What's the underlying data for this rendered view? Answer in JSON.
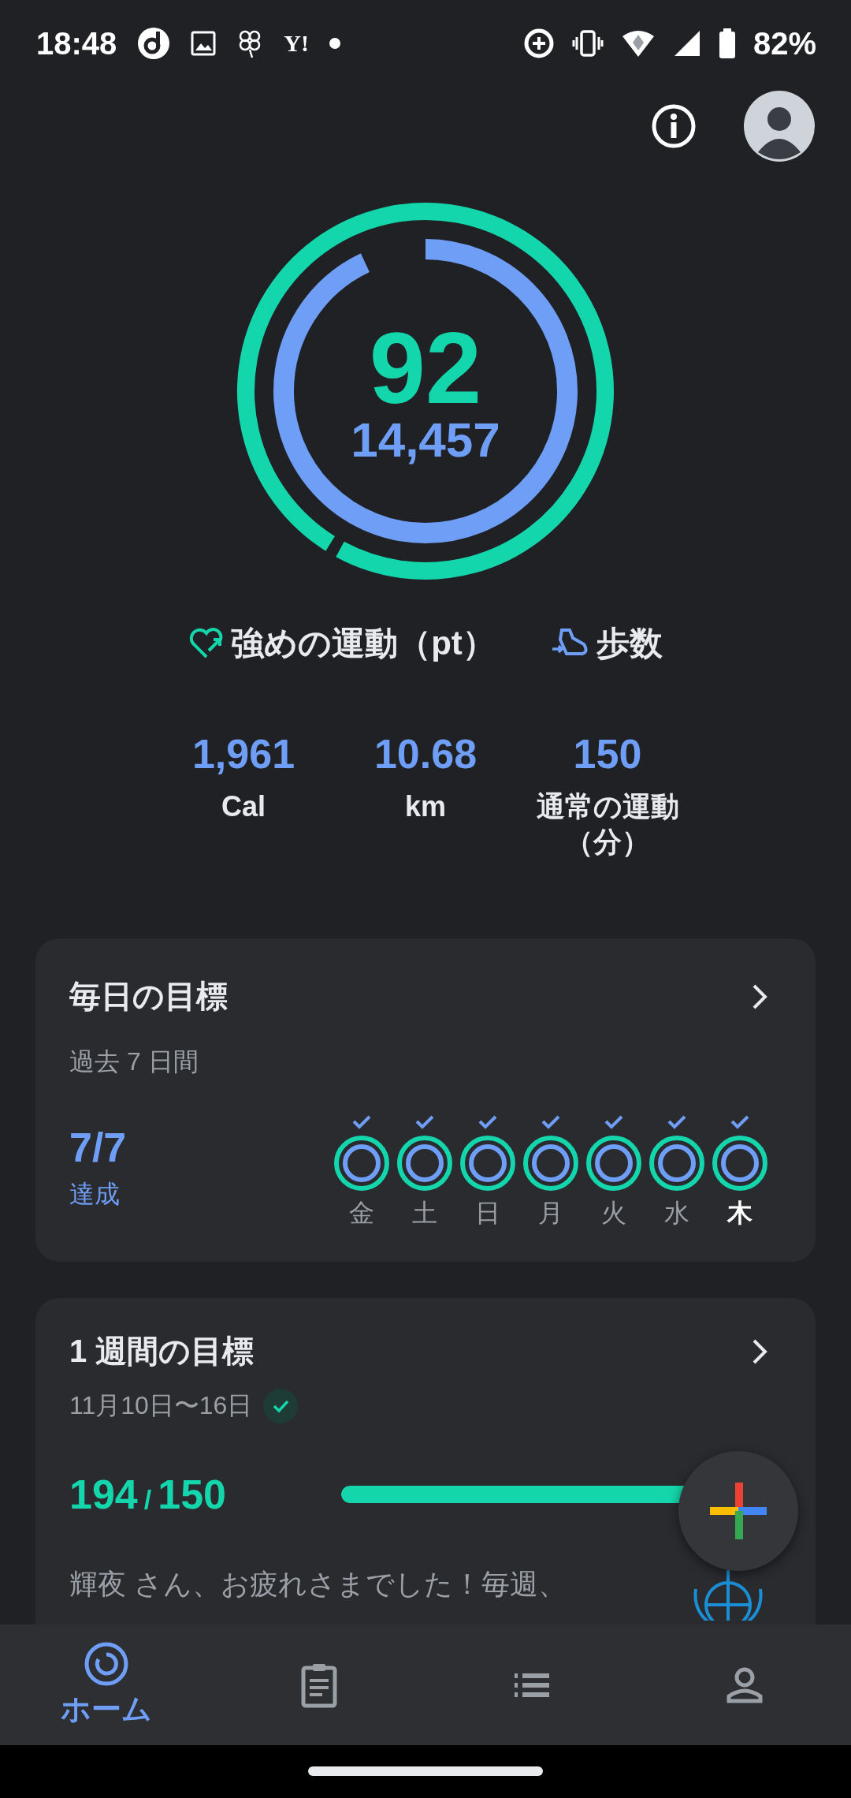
{
  "status_bar": {
    "time": "18:48",
    "notification_text": "Y!",
    "battery": "82%"
  },
  "rings": {
    "heart_points": {
      "value": "92",
      "level": 0.99
    },
    "steps": {
      "value": "14,457",
      "level": 0.93
    }
  },
  "legend": [
    {
      "kind": "heart",
      "label": "強めの運動（pt）"
    },
    {
      "kind": "steps",
      "label": "歩数"
    }
  ],
  "stats": [
    {
      "value": "1,961",
      "label": "Cal"
    },
    {
      "value": "10.68",
      "label": "km"
    },
    {
      "value": "150",
      "label": "通常の運動（分）"
    }
  ],
  "daily_goal": {
    "title": "毎日の目標",
    "subtitle": "過去 7 日間",
    "count": "7/7",
    "status": "達成",
    "days": [
      {
        "label": "金",
        "checked": true,
        "selected": false
      },
      {
        "label": "土",
        "checked": true,
        "selected": false
      },
      {
        "label": "日",
        "checked": true,
        "selected": false
      },
      {
        "label": "月",
        "checked": true,
        "selected": false
      },
      {
        "label": "火",
        "checked": true,
        "selected": false
      },
      {
        "label": "水",
        "checked": true,
        "selected": false
      },
      {
        "label": "木",
        "checked": true,
        "selected": true
      }
    ]
  },
  "weekly_goal": {
    "title": "1 週間の目標",
    "date_range": "11月10日〜16日",
    "achieved": true,
    "progress": "194",
    "separator": "/",
    "goal": "150",
    "level": 1,
    "message": "輝夜 さん、お疲れさまでした！毎週、"
  },
  "nav": [
    {
      "kind": "home",
      "label": "ホーム",
      "selected": true
    },
    {
      "kind": "journal",
      "selected": false
    },
    {
      "kind": "browse",
      "selected": false
    },
    {
      "kind": "profile",
      "selected": false
    }
  ]
}
